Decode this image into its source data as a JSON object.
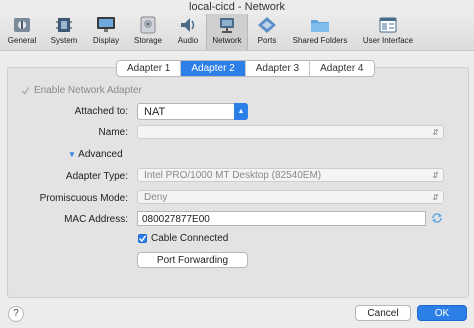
{
  "window": {
    "title": "local-cicd - Network"
  },
  "toolbar": {
    "items": [
      {
        "label": "General",
        "icon": "general-icon"
      },
      {
        "label": "System",
        "icon": "system-chip-icon"
      },
      {
        "label": "Display",
        "icon": "display-monitor-icon"
      },
      {
        "label": "Storage",
        "icon": "storage-disk-icon"
      },
      {
        "label": "Audio",
        "icon": "audio-speaker-icon"
      },
      {
        "label": "Network",
        "icon": "network-icon"
      },
      {
        "label": "Ports",
        "icon": "ports-icon"
      },
      {
        "label": "Shared Folders",
        "icon": "folder-icon"
      },
      {
        "label": "User Interface",
        "icon": "user-interface-icon"
      }
    ],
    "active": "Network"
  },
  "tabs": [
    "Adapter 1",
    "Adapter 2",
    "Adapter 3",
    "Adapter 4"
  ],
  "selected_tab": "Adapter 2",
  "form": {
    "enable_label": "Enable Network Adapter",
    "attached_label": "Attached to:",
    "attached_value": "NAT",
    "name_label": "Name:",
    "name_value": "",
    "advanced_label": "Advanced",
    "adapter_type_label": "Adapter Type:",
    "adapter_type_value": "Intel PRO/1000 MT Desktop (82540EM)",
    "promiscuous_label": "Promiscuous Mode:",
    "promiscuous_value": "Deny",
    "mac_label": "MAC Address:",
    "mac_value": "080027877E00",
    "cable_label": "Cable Connected",
    "port_forwarding_label": "Port Forwarding"
  },
  "footer": {
    "help": "?",
    "cancel": "Cancel",
    "ok": "OK"
  },
  "colors": {
    "accent": "#2b7fe6",
    "background": "#ececec"
  }
}
